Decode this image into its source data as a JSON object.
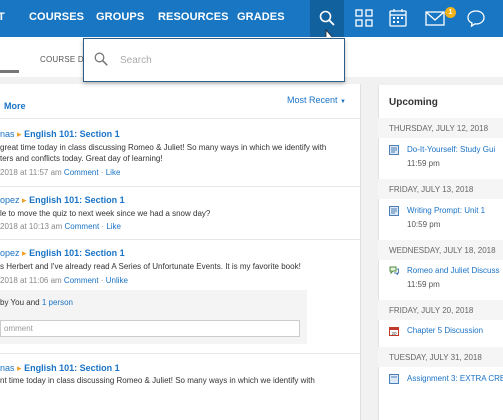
{
  "nav": {
    "items": [
      "COURSES",
      "GROUPS",
      "RESOURCES",
      "GRADES"
    ],
    "badge_count": "1",
    "icons": [
      "search-icon",
      "apps-grid-icon",
      "calendar-icon",
      "mail-icon",
      "chat-icon"
    ]
  },
  "subnav": {
    "course_tab": "COURSE D"
  },
  "search": {
    "placeholder": "Search",
    "value": ""
  },
  "feed": {
    "more_label": "More",
    "sort_label": "Most Recent",
    "posts": [
      {
        "author": "nas",
        "group": "English 101: Section 1",
        "lines": [
          "great time today in class discussing Romeo & Juliet! So many ways in which we identify with",
          "ters and conflicts today. Great day of learning!"
        ],
        "meta": "2018 at 11:57 am",
        "actions": [
          "Comment",
          "Like"
        ]
      },
      {
        "author": "opez",
        "group": "English 101: Section 1",
        "lines": [
          "le to move the quiz to next week since we had a snow day?"
        ],
        "meta": "2018 at 10:13 am",
        "actions": [
          "Comment",
          "Like"
        ]
      },
      {
        "author": "opez",
        "group": "English 101: Section 1",
        "lines": [
          "s Herbert and I've already read A Series of Unfortunate Events. It is my favorite book!"
        ],
        "meta": "2018 at 11:06 am",
        "actions": [
          "Comment",
          "Unlike"
        ]
      },
      {
        "author": "nas",
        "group": "English 101: Section 1",
        "lines": [
          "nt time today in class discussing Romeo & Juliet! So many ways in which we identify with"
        ],
        "meta": "",
        "actions": []
      }
    ],
    "likes": {
      "prefix": "by You and",
      "link": "1 person"
    },
    "comment_placeholder": "omment"
  },
  "upcoming": {
    "title": "Upcoming",
    "days": [
      {
        "date": "THURSDAY, JULY 12, 2018",
        "item": "Do-It-Yourself: Study Gui",
        "time": "11:59 pm",
        "icon": "assignment-icon"
      },
      {
        "date": "FRIDAY, JULY 13, 2018",
        "item": "Writing Prompt: Unit 1",
        "time": "10:59 pm",
        "icon": "assignment-icon"
      },
      {
        "date": "WEDNESDAY, JULY 18, 2018",
        "item": "Romeo and Juliet Discuss",
        "time": "11:59 pm",
        "icon": "discussion-icon"
      },
      {
        "date": "FRIDAY, JULY 20, 2018",
        "item": "Chapter 5 Discussion",
        "time": "",
        "icon": "event-icon"
      },
      {
        "date": "TUESDAY, JULY 31, 2018",
        "item": "Assignment 3: EXTRA CRE",
        "time": "",
        "icon": "assignment-icon"
      }
    ]
  },
  "colors": {
    "nav_bg": "#1976c2",
    "link": "#1a73c6",
    "badge": "#f2b21c",
    "chevron": "#f0a12b"
  }
}
